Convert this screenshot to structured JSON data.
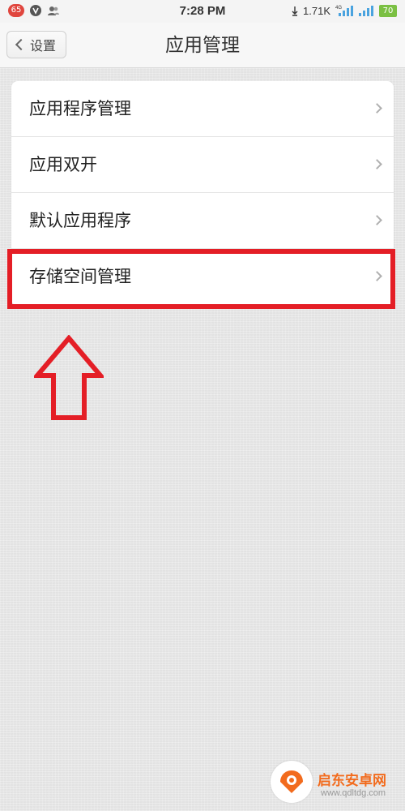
{
  "status_bar": {
    "notification_count": "65",
    "time": "7:28 PM",
    "net_speed": "1.71K",
    "battery_level": "70"
  },
  "header": {
    "back_label": "设置",
    "title": "应用管理"
  },
  "list": {
    "items": [
      {
        "label": "应用程序管理"
      },
      {
        "label": "应用双开"
      },
      {
        "label": "默认应用程序"
      },
      {
        "label": "存储空间管理"
      }
    ]
  },
  "annotation": {
    "highlight_color": "#e41e26"
  },
  "watermark": {
    "title": "启东安卓网",
    "url": "www.qdltdg.com"
  }
}
